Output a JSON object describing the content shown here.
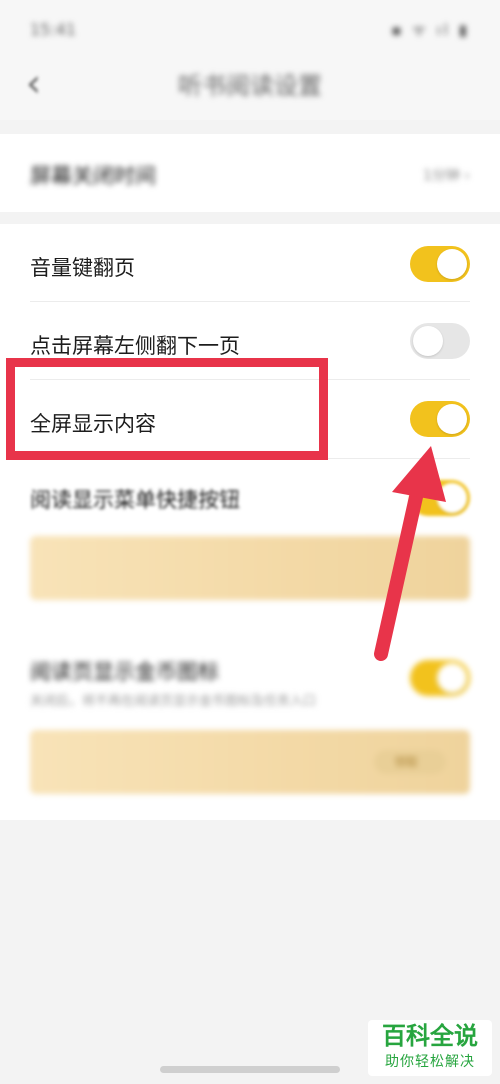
{
  "status_bar": {
    "time": "15:41",
    "icons": "▪ ᯤ ıl ▮"
  },
  "header": {
    "back_icon": "‹",
    "title": "听书阅读设置"
  },
  "section1": {
    "label": "屏幕关闭时间",
    "value": "1分钟 ›"
  },
  "settings": [
    {
      "label": "音量键翻页",
      "state": "on"
    },
    {
      "label": "点击屏幕左侧翻下一页",
      "state": "off"
    },
    {
      "label": "全屏显示内容",
      "state": "on"
    },
    {
      "label": "阅读显示菜单快捷按钮",
      "state": "on"
    }
  ],
  "chapter_row": {
    "label": "阅读页显示金币图标",
    "subtext": "关闭后，将不再在阅读页显示金币图标及任务入口",
    "state": "on"
  },
  "banner2_button": "领取",
  "colors": {
    "accent": "#f2c21d",
    "annotation": "#e8344a",
    "watermark": "#27a53f"
  },
  "watermark": {
    "title": "百科全说",
    "subtitle": "助你轻松解决"
  }
}
